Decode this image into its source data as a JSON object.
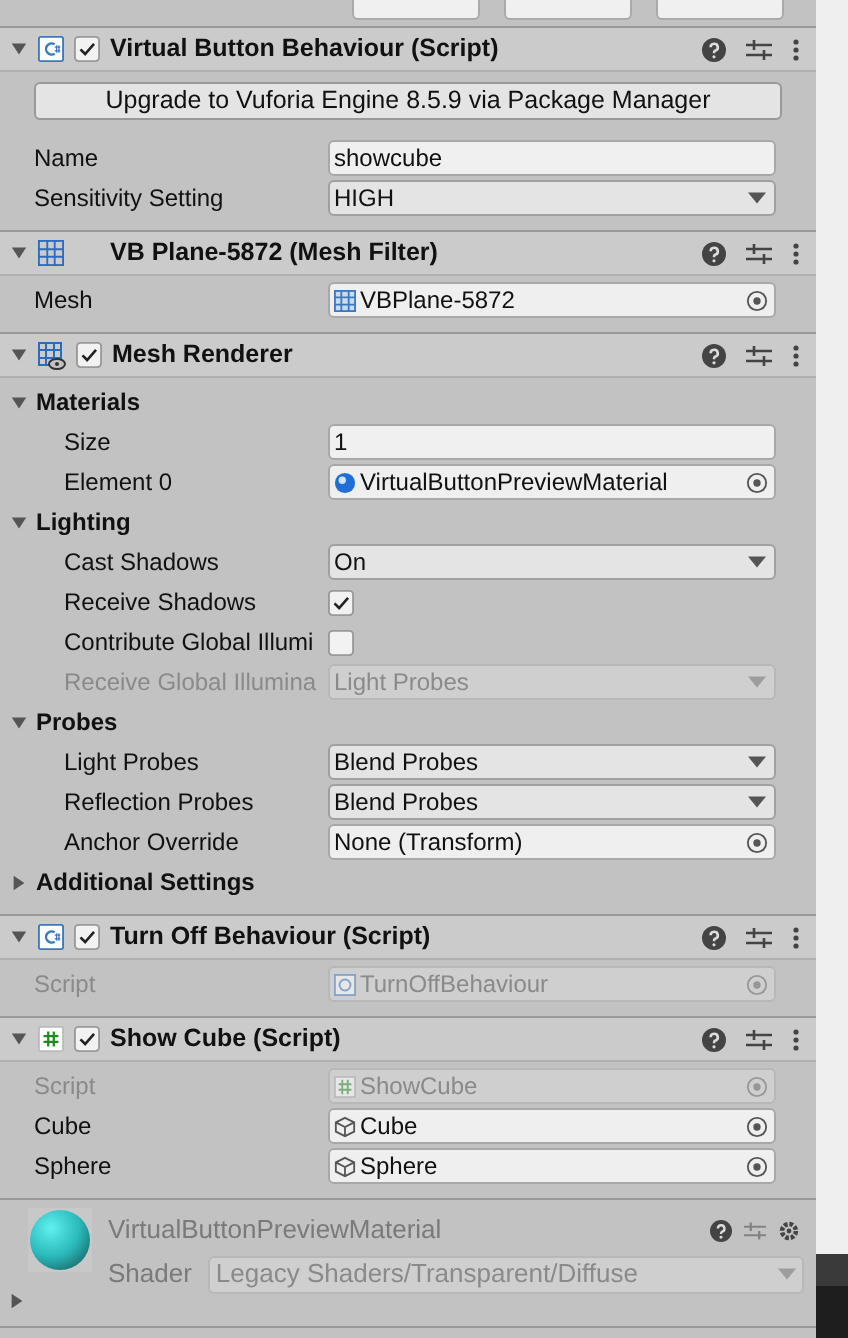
{
  "components": [
    {
      "title": "Virtual Button Behaviour (Script)",
      "enabled": true,
      "expanded": true,
      "rows": [
        {
          "kind": "button",
          "label": "Upgrade to Vuforia Engine 8.5.9 via Package Manager"
        },
        {
          "kind": "text",
          "label": "Name",
          "value": "showcube",
          "disabled": false
        },
        {
          "kind": "dropdown",
          "label": "Sensitivity Setting",
          "value": "HIGH",
          "disabled": false
        }
      ]
    },
    {
      "title": "VB Plane-5872 (Mesh Filter)",
      "expanded": true,
      "rows": [
        {
          "kind": "object",
          "label": "Mesh",
          "value": "VBPlane-5872",
          "disabled": false
        }
      ]
    },
    {
      "title": "Mesh Renderer",
      "enabled": true,
      "expanded": true,
      "rows": [
        {
          "kind": "section",
          "label": "Materials",
          "expanded": true,
          "children": [
            {
              "kind": "text",
              "label": "Size",
              "value": "1",
              "disabled": false
            },
            {
              "kind": "object",
              "label": "Element 0",
              "value": "VirtualButtonPreviewMaterial",
              "disabled": false
            }
          ]
        },
        {
          "kind": "section",
          "label": "Lighting",
          "expanded": true,
          "children": [
            {
              "kind": "dropdown",
              "label": "Cast Shadows",
              "value": "On",
              "disabled": false
            },
            {
              "kind": "checkbox",
              "label": "Receive Shadows",
              "checked": true,
              "disabled": false
            },
            {
              "kind": "checkbox",
              "label": "Contribute Global Illumi",
              "checked": false,
              "disabled": false
            },
            {
              "kind": "dropdown",
              "label": "Receive Global Illumina",
              "value": "Light Probes",
              "disabled": true
            }
          ]
        },
        {
          "kind": "section",
          "label": "Probes",
          "expanded": true,
          "children": [
            {
              "kind": "dropdown",
              "label": "Light Probes",
              "value": "Blend Probes",
              "disabled": false
            },
            {
              "kind": "dropdown",
              "label": "Reflection Probes",
              "value": "Blend Probes",
              "disabled": false
            },
            {
              "kind": "object",
              "label": "Anchor Override",
              "value": "None (Transform)",
              "disabled": false
            }
          ]
        },
        {
          "kind": "section",
          "label": "Additional Settings",
          "expanded": false,
          "children": []
        }
      ]
    },
    {
      "title": "Turn Off Behaviour (Script)",
      "enabled": true,
      "expanded": true,
      "rows": [
        {
          "kind": "object",
          "label": "Script",
          "value": "TurnOffBehaviour",
          "disabled": true
        }
      ]
    },
    {
      "title": "Show Cube (Script)",
      "enabled": true,
      "expanded": true,
      "rows": [
        {
          "kind": "object",
          "label": "Script",
          "value": "ShowCube",
          "disabled": true
        },
        {
          "kind": "object",
          "label": "Cube",
          "value": "Cube",
          "disabled": false
        },
        {
          "kind": "object",
          "label": "Sphere",
          "value": "Sphere",
          "disabled": false
        }
      ]
    }
  ],
  "material": {
    "name": "VirtualButtonPreviewMaterial",
    "shader_label": "Shader",
    "shader": "Legacy Shaders/Transparent/Diffuse",
    "expanded": false
  }
}
